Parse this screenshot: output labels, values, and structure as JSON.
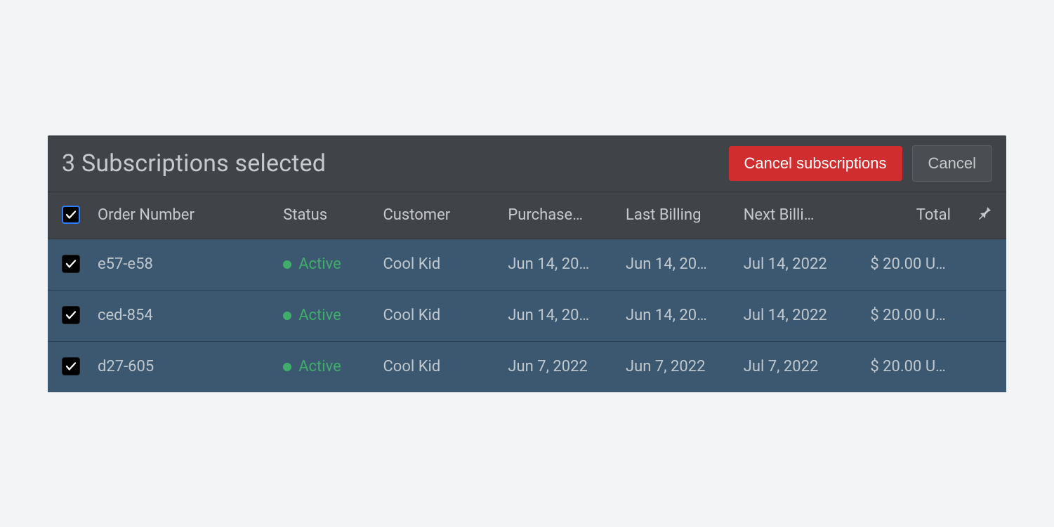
{
  "header": {
    "title": "3 Subscriptions selected",
    "cancel_subscriptions_label": "Cancel subscriptions",
    "cancel_label": "Cancel"
  },
  "columns": {
    "order_number": "Order Number",
    "status": "Status",
    "customer": "Customer",
    "purchase": "Purchase…",
    "last_billing": "Last Billing",
    "next_billing": "Next Billi…",
    "total": "Total"
  },
  "rows": [
    {
      "order_number": "e57-e58",
      "status": "Active",
      "customer": "Cool Kid",
      "purchase": "Jun 14, 20…",
      "last_billing": "Jun 14, 20…",
      "next_billing": "Jul 14, 2022",
      "total": "$ 20.00 U…"
    },
    {
      "order_number": "ced-854",
      "status": "Active",
      "customer": "Cool Kid",
      "purchase": "Jun 14, 20…",
      "last_billing": "Jun 14, 20…",
      "next_billing": "Jul 14, 2022",
      "total": "$ 20.00 U…"
    },
    {
      "order_number": "d27-605",
      "status": "Active",
      "customer": "Cool Kid",
      "purchase": "Jun 7, 2022",
      "last_billing": "Jun 7, 2022",
      "next_billing": "Jul 7, 2022",
      "total": "$ 20.00 U…"
    }
  ]
}
